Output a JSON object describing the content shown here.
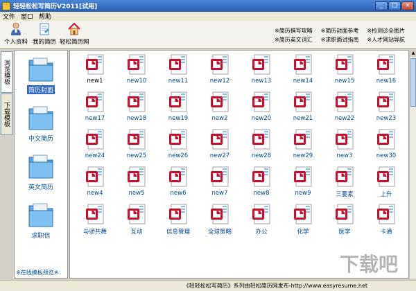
{
  "window": {
    "title": "轻轻松松写简历V2011[试用]",
    "controls": [
      "_",
      "□",
      "×"
    ]
  },
  "menu": [
    "文件",
    "窗口",
    "帮助"
  ],
  "toolbar": {
    "buttons": [
      {
        "label": "个人资料",
        "icon": "person-icon"
      },
      {
        "label": "我的简历",
        "icon": "document-icon"
      },
      {
        "label": "轻松简历网",
        "icon": "house-icon"
      }
    ],
    "links": [
      "※简历撰写攻略",
      "※简历封面参考",
      "※检测诊全图片",
      "※简历英文词汇",
      "※求职面试指南",
      "※人才网站导航"
    ]
  },
  "vtabs": [
    {
      "label": "浏览模板"
    },
    {
      "label": "下载模板"
    }
  ],
  "folders": [
    {
      "label": "简历封面"
    },
    {
      "label": "中文简历"
    },
    {
      "label": "英文简历"
    },
    {
      "label": "求职信"
    }
  ],
  "folder_more": "※在线模板预览※",
  "templates": [
    "new1",
    "new10",
    "new11",
    "new12",
    "new13",
    "new14",
    "new15",
    "new16",
    "new17",
    "new18",
    "new19",
    "new2",
    "new20",
    "new21",
    "new22",
    "new23",
    "new24",
    "new25",
    "new26",
    "new27",
    "new28",
    "new29",
    "new3",
    "new30",
    "new4",
    "new5",
    "new6",
    "new7",
    "new8",
    "new9",
    "三要素",
    "上升",
    "与骄共舞",
    "互动",
    "信息管理",
    "全球策略",
    "办公",
    "化学",
    "医学",
    "卡通"
  ],
  "status_text": "《轻轻松松写简历》系列由轻松简历网发布-http://www.easyresume.net",
  "watermark": "下载吧",
  "colors": {
    "title_bar": "#2a5fb0",
    "doc_red": "#c8102e",
    "selected": "#316ac5"
  }
}
